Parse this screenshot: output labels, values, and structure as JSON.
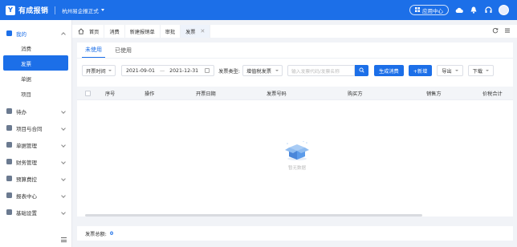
{
  "header": {
    "logo_char": "Y",
    "brand": "有成报销",
    "company": "杭州易企报正式",
    "app_center": "应用中心",
    "colors": {
      "primary": "#1c6fe8"
    },
    "icons": [
      "cloud-upload-icon",
      "bell-icon",
      "headset-icon",
      "avatar"
    ]
  },
  "sidebar": {
    "groups": [
      {
        "label": "我的",
        "icon": "user-icon",
        "open": true,
        "items": [
          {
            "label": "消费",
            "active": false
          },
          {
            "label": "发票",
            "active": true
          },
          {
            "label": "单据",
            "active": false
          },
          {
            "label": "项目",
            "active": false
          }
        ]
      },
      {
        "label": "待办",
        "icon": "todo-icon"
      },
      {
        "label": "项目与合同",
        "icon": "contract-icon"
      },
      {
        "label": "单据管理",
        "icon": "document-icon"
      },
      {
        "label": "财务管理",
        "icon": "finance-icon"
      },
      {
        "label": "预算费控",
        "icon": "budget-icon"
      },
      {
        "label": "报表中心",
        "icon": "report-icon"
      },
      {
        "label": "基础设置",
        "icon": "settings-icon"
      }
    ]
  },
  "tabs": [
    {
      "label": "首页",
      "active": false
    },
    {
      "label": "消费",
      "active": false
    },
    {
      "label": "新建报销单",
      "active": false
    },
    {
      "label": "审批",
      "active": false
    },
    {
      "label": "发票",
      "active": true,
      "closable": true
    }
  ],
  "subtabs": [
    {
      "label": "未使用",
      "active": true
    },
    {
      "label": "已使用",
      "active": false
    }
  ],
  "filters": {
    "time_type": "开票时间",
    "date_start": "2021-09-01",
    "date_sep": "—",
    "date_end": "2021-12-31",
    "invoice_type_label": "发票类型:",
    "invoice_type_value": "增值税发票",
    "search_placeholder": "输入发票代码/发票名称",
    "btn_generate": "生成消费",
    "btn_new": "+新增",
    "btn_export": "导出",
    "btn_download": "下载"
  },
  "table": {
    "columns": [
      "序号",
      "操作",
      "开票日期",
      "发票号码",
      "购买方",
      "销售方",
      "价税合计"
    ],
    "rows": [],
    "empty_text": "暂无数据"
  },
  "footer": {
    "total_label": "发票总额:",
    "total_value": "0"
  }
}
